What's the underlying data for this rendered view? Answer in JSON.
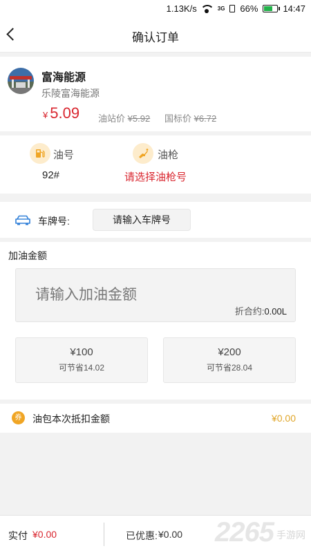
{
  "status_bar": {
    "speed": "1.13K/s",
    "network": "3G",
    "battery_percent": "66%",
    "battery_level": 0.66,
    "time": "14:47"
  },
  "header": {
    "title": "确认订单"
  },
  "station": {
    "name": "富海能源",
    "subname": "乐陵富海能源",
    "currency": "¥",
    "price": "5.09",
    "station_price_label": "油站价",
    "station_price": "¥5.92",
    "national_price_label": "国标价",
    "national_price": "¥6.72"
  },
  "fuel": {
    "number_label": "油号",
    "number_value": "92#",
    "gun_label": "油枪",
    "gun_placeholder": "请选择油枪号"
  },
  "plate": {
    "label": "车牌号:",
    "placeholder": "请输入车牌号"
  },
  "amount": {
    "title": "加油金额",
    "placeholder": "请输入加油金额",
    "conversion_label": "折合约:",
    "conversion_value": "0.00L",
    "presets": [
      {
        "amount": "¥100",
        "saving": "可节省14.02"
      },
      {
        "amount": "¥200",
        "saving": "可节省28.04"
      }
    ]
  },
  "voucher": {
    "icon_text": "券",
    "label": "油包本次抵扣金额",
    "value": "¥0.00"
  },
  "footer": {
    "paid_label": "实付",
    "paid_value": "¥0.00",
    "discount_label": "已优惠:",
    "discount_value": "¥0.00"
  },
  "watermark": {
    "number": "2265",
    "text": "手游网"
  },
  "colors": {
    "accent_red": "#d9262f",
    "accent_orange": "#f0a524",
    "voucher_value": "#e0a62a"
  }
}
